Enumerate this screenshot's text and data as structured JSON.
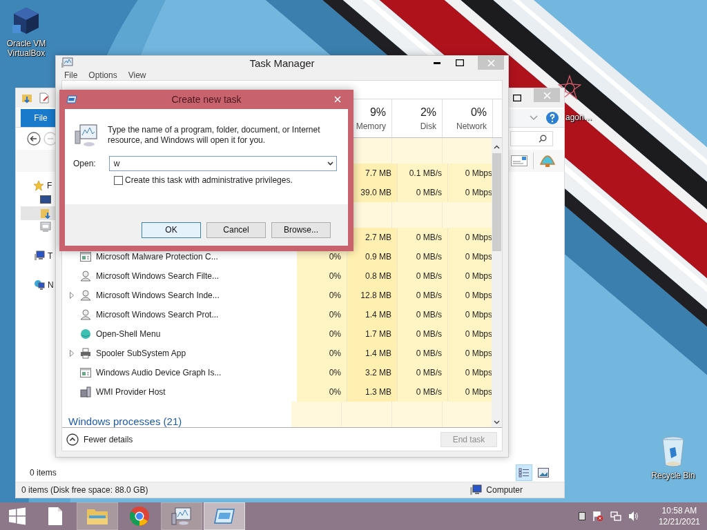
{
  "desktop": {
    "icons": [
      {
        "kind": "virtualbox",
        "label": "Oracle VM VirtualBox"
      },
      {
        "kind": "star",
        "label": "agon…"
      },
      {
        "kind": "recycle",
        "label": "Recycle Bin"
      }
    ]
  },
  "explorer": {
    "file_tab": "File",
    "nav_items": [
      {
        "kind": "favorites",
        "label": "F",
        "selected": false
      },
      {
        "kind": "desktop",
        "selected": false
      },
      {
        "kind": "downloads",
        "selected": true
      },
      {
        "kind": "recent",
        "selected": false
      },
      {
        "kind": "computer",
        "label": "T",
        "selected": false
      },
      {
        "kind": "network",
        "label": "N",
        "selected": false
      }
    ],
    "item_count": "0 items",
    "view_buttons": [
      {
        "kind": "details",
        "selected": true
      },
      {
        "kind": "large",
        "selected": false
      }
    ],
    "status": "0 items (Disk free space: 88.0 GB)",
    "location": "Computer"
  },
  "task_manager": {
    "title": "Task Manager",
    "menu": [
      "File",
      "Options",
      "View"
    ],
    "columns": [
      {
        "percent": "9%",
        "label": "Memory"
      },
      {
        "percent": "2%",
        "label": "Disk"
      },
      {
        "percent": "0%",
        "label": "Network"
      }
    ],
    "rows": [
      {
        "kind": "group"
      },
      {
        "kind": "process",
        "memory": "7.7 MB",
        "disk": "0.1 MB/s",
        "network": "0 Mbps"
      },
      {
        "kind": "process",
        "memory": "39.0 MB",
        "disk": "0 MB/s",
        "network": "0 Mbps"
      },
      {
        "kind": "group"
      },
      {
        "kind": "process",
        "memory": "2.7 MB",
        "disk": "0 MB/s",
        "network": "0 Mbps"
      },
      {
        "kind": "window",
        "expander": false,
        "name": "Microsoft Malware Protection C...",
        "cpu": "0%",
        "memory": "0.9 MB",
        "disk": "0 MB/s",
        "network": "0 Mbps"
      },
      {
        "kind": "user",
        "expander": false,
        "name": "Microsoft Windows Search Filte...",
        "cpu": "0%",
        "memory": "0.8 MB",
        "disk": "0 MB/s",
        "network": "0 Mbps"
      },
      {
        "kind": "user",
        "expander": true,
        "name": "Microsoft Windows Search Inde...",
        "cpu": "0%",
        "memory": "12.8 MB",
        "disk": "0 MB/s",
        "network": "0 Mbps"
      },
      {
        "kind": "user",
        "expander": false,
        "name": "Microsoft Windows Search Prot...",
        "cpu": "0%",
        "memory": "1.4 MB",
        "disk": "0 MB/s",
        "network": "0 Mbps"
      },
      {
        "kind": "globe",
        "expander": false,
        "name": "Open-Shell Menu",
        "cpu": "0%",
        "memory": "1.7 MB",
        "disk": "0 MB/s",
        "network": "0 Mbps"
      },
      {
        "kind": "printer",
        "expander": true,
        "name": "Spooler SubSystem App",
        "cpu": "0%",
        "memory": "1.4 MB",
        "disk": "0 MB/s",
        "network": "0 Mbps"
      },
      {
        "kind": "window",
        "expander": false,
        "name": "Windows Audio Device Graph Is...",
        "cpu": "0%",
        "memory": "3.2 MB",
        "disk": "0 MB/s",
        "network": "0 Mbps"
      },
      {
        "kind": "host",
        "expander": false,
        "name": "WMI Provider Host",
        "cpu": "0%",
        "memory": "1.3 MB",
        "disk": "0 MB/s",
        "network": "0 Mbps"
      },
      {
        "kind": "group",
        "label": "Windows processes (21)"
      }
    ],
    "fewer_details": "Fewer details",
    "end_task": {
      "label": "End task",
      "disabled": true
    }
  },
  "dialog": {
    "title": "Create new task",
    "message": "Type the name of a program, folder, document, or Internet resource, and Windows will open it for you.",
    "open_label": "Open:",
    "open_value": "w",
    "admin_checkbox": {
      "label": "Create this task with administrative privileges.",
      "checked": false
    },
    "buttons": [
      {
        "label": "OK",
        "default": true
      },
      {
        "label": "Cancel",
        "default": false
      },
      {
        "label": "Browse...",
        "default": false
      }
    ]
  },
  "taskbar": {
    "buttons": [
      {
        "kind": "start",
        "running": false,
        "active": false
      },
      {
        "kind": "file",
        "running": false,
        "active": false
      },
      {
        "kind": "explorer",
        "running": true,
        "active": false
      },
      {
        "kind": "chrome",
        "running": false,
        "active": false
      },
      {
        "kind": "monitor",
        "running": true,
        "active": false
      },
      {
        "kind": "run",
        "running": true,
        "active": true
      }
    ],
    "time": "10:58 AM",
    "date": "12/21/2021"
  }
}
